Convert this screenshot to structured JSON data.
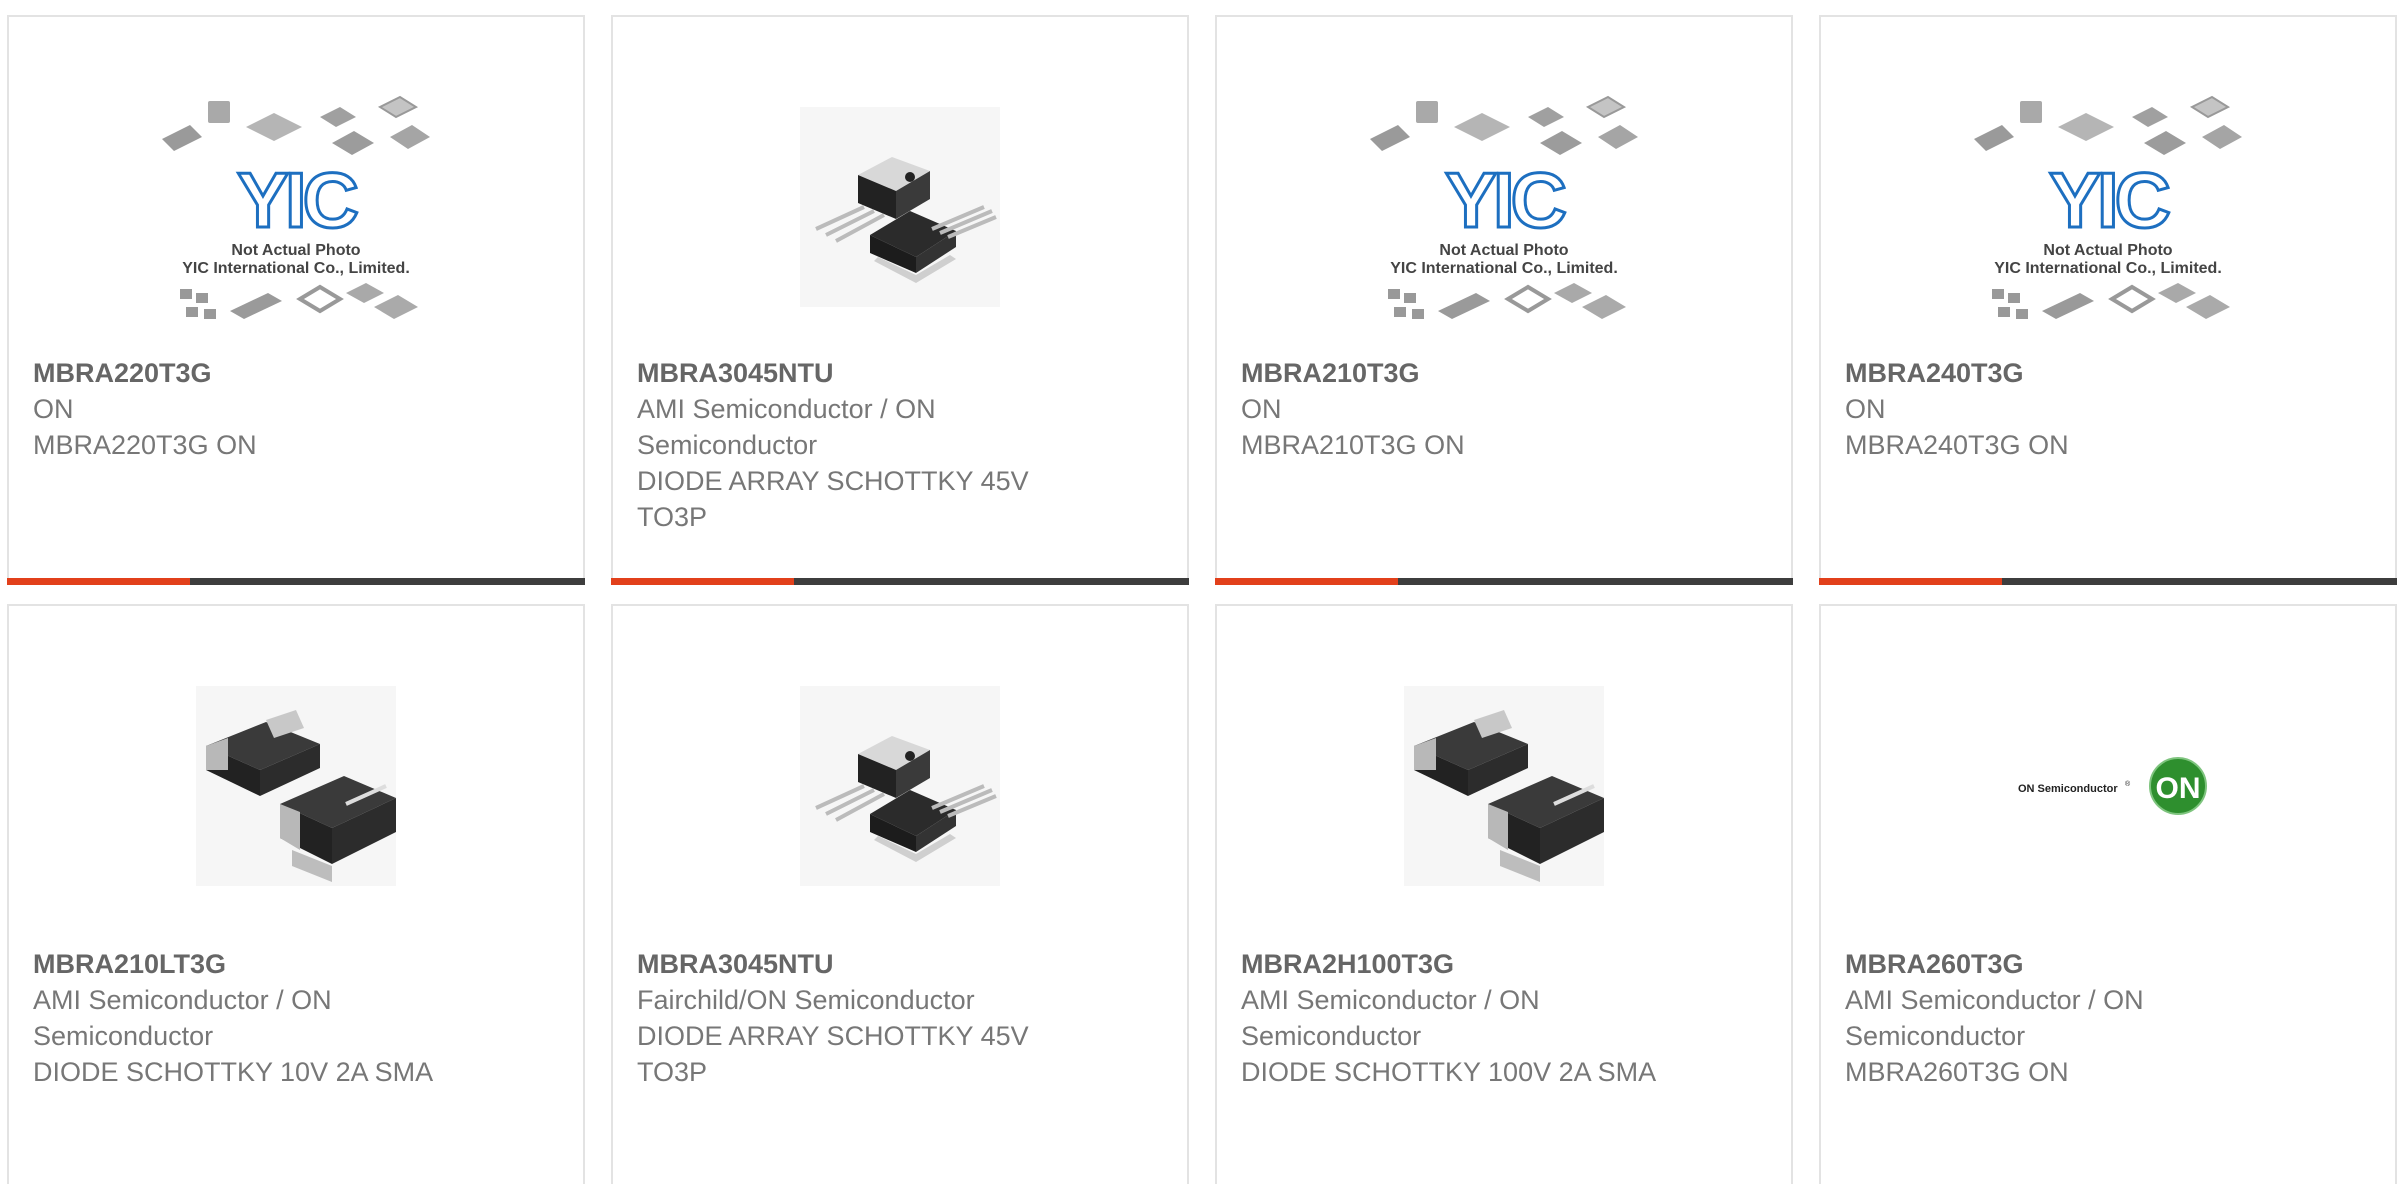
{
  "colors": {
    "accent": "#e2401b",
    "bar_dark": "#3d3d3d",
    "text": "#666666",
    "logo_blue": "#1d6fc0",
    "on_green": "#2e8f2e"
  },
  "placeholder": {
    "line1": "Not Actual Photo",
    "line2": "YIC International Co., Limited.",
    "logo_text": "YIC"
  },
  "on_logo": {
    "wordmark": "ON Semiconductor",
    "badge": "ON"
  },
  "products": [
    {
      "pn": "MBRA220T3G",
      "mfr": "ON",
      "desc": "MBRA220T3G ON",
      "image": "yic-placeholder-icon"
    },
    {
      "pn": "MBRA3045NTU",
      "mfr": "AMI Semiconductor / ON Semiconductor",
      "desc": "DIODE ARRAY SCHOTTKY 45V TO3P",
      "image": "to3p-package-icon"
    },
    {
      "pn": "MBRA210T3G",
      "mfr": "ON",
      "desc": "MBRA210T3G ON",
      "image": "yic-placeholder-icon"
    },
    {
      "pn": "MBRA240T3G",
      "mfr": "ON",
      "desc": "MBRA240T3G ON",
      "image": "yic-placeholder-icon"
    },
    {
      "pn": "MBRA210LT3G",
      "mfr": "AMI Semiconductor / ON Semiconductor",
      "desc": "DIODE SCHOTTKY 10V 2A SMA",
      "image": "sma-package-icon"
    },
    {
      "pn": "MBRA3045NTU",
      "mfr": "Fairchild/ON Semiconductor",
      "desc": "DIODE ARRAY SCHOTTKY 45V TO3P",
      "image": "to3p-package-icon"
    },
    {
      "pn": "MBRA2H100T3G",
      "mfr": "AMI Semiconductor / ON Semiconductor",
      "desc": "DIODE SCHOTTKY 100V 2A SMA",
      "image": "sma-package-icon"
    },
    {
      "pn": "MBRA260T3G",
      "mfr": "AMI Semiconductor / ON Semiconductor",
      "desc": "MBRA260T3G ON",
      "image": "on-semiconductor-logo"
    }
  ]
}
